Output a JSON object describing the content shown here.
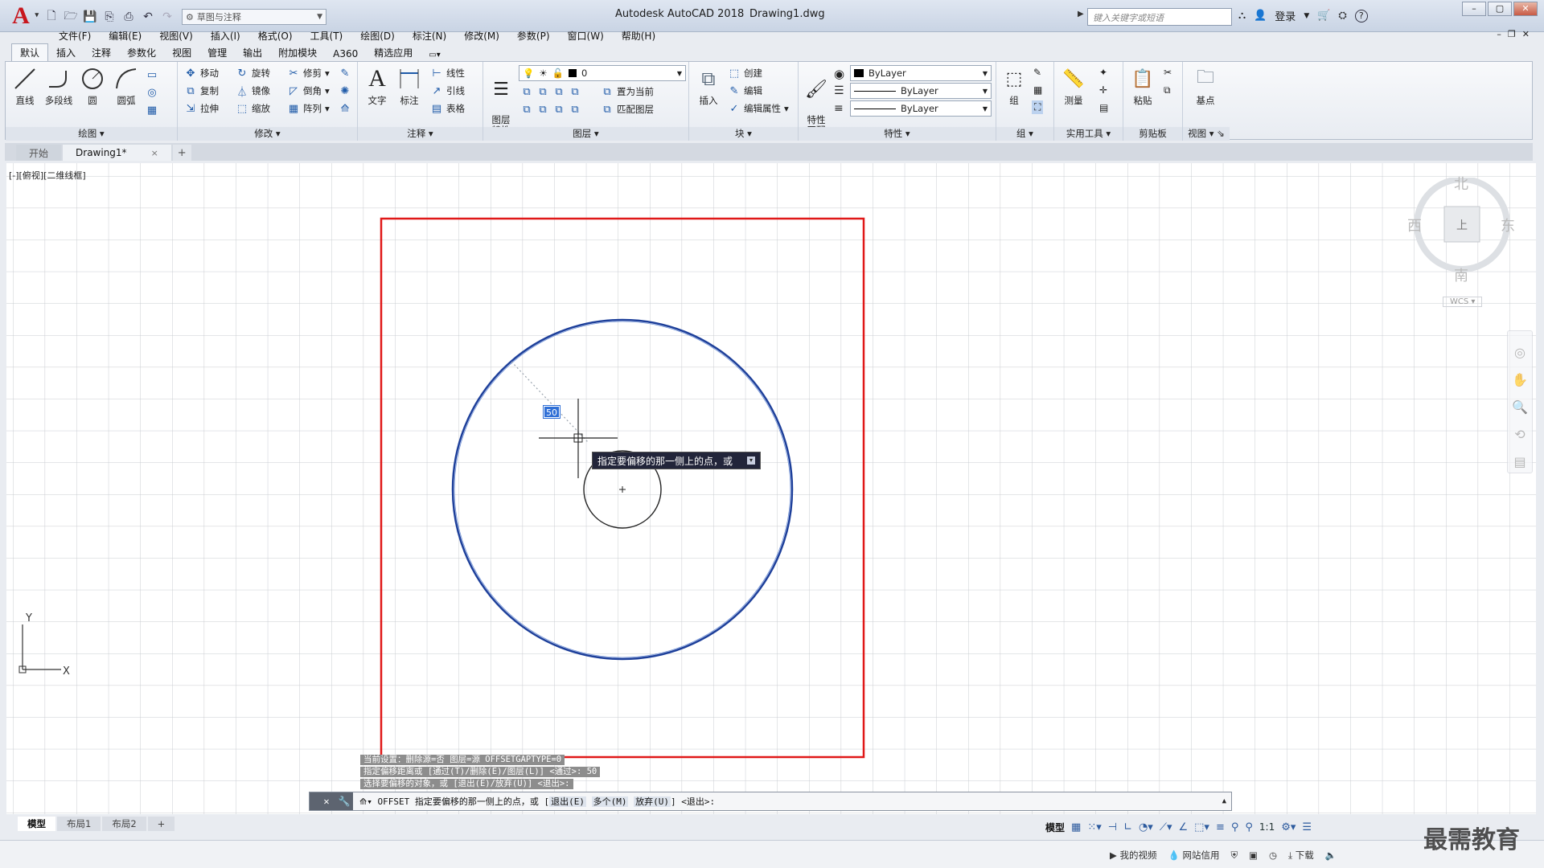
{
  "app": {
    "logo_letter": "A",
    "title": "Autodesk AutoCAD 2018",
    "file": "Drawing1.dwg",
    "workspace": "草图与注释",
    "search_placeholder": "键入关键字或短语",
    "login": "登录",
    "help": "?"
  },
  "menu": [
    "文件(F)",
    "编辑(E)",
    "视图(V)",
    "插入(I)",
    "格式(O)",
    "工具(T)",
    "绘图(D)",
    "标注(N)",
    "修改(M)",
    "参数(P)",
    "窗口(W)",
    "帮助(H)"
  ],
  "ribbon_tabs": [
    "默认",
    "插入",
    "注释",
    "参数化",
    "视图",
    "管理",
    "输出",
    "附加模块",
    "A360",
    "精选应用"
  ],
  "ribbon": {
    "draw": {
      "title": "绘图",
      "big": [
        "直线",
        "多段线",
        "圆",
        "圆弧"
      ]
    },
    "modify": {
      "title": "修改",
      "rows": [
        [
          "移动",
          "旋转",
          "修剪"
        ],
        [
          "复制",
          "镜像",
          "倒角"
        ],
        [
          "拉伸",
          "缩放",
          "阵列"
        ]
      ]
    },
    "annotation": {
      "title": "注释",
      "big": [
        "文字",
        "标注"
      ],
      "rows": [
        "线性",
        "引线",
        "表格"
      ]
    },
    "layers": {
      "title": "图层",
      "big": "图层\n特性",
      "layer_value": "0",
      "rows": [
        "置为当前",
        "匹配图层"
      ]
    },
    "block": {
      "title": "块",
      "big": "插入",
      "rows": [
        "创建",
        "编辑",
        "编辑属性"
      ]
    },
    "properties": {
      "title": "特性",
      "big": "特性\n匹配",
      "color": "ByLayer",
      "linetype": "ByLayer",
      "lineweight": "ByLayer"
    },
    "groups": {
      "title": "组",
      "big": "组"
    },
    "utilities": {
      "title": "实用工具",
      "big": "测量"
    },
    "clipboard": {
      "title": "剪贴板",
      "big": "粘贴"
    },
    "view": {
      "title": "视图",
      "big": "基点"
    }
  },
  "file_tabs": [
    {
      "label": "开始",
      "active": false
    },
    {
      "label": "Drawing1*",
      "active": true,
      "close": "×"
    }
  ],
  "viewport_label": "[-][俯视][二维线框]",
  "viewcube": {
    "north": "北",
    "south": "南",
    "east": "东",
    "west": "西",
    "wcs": "WCS"
  },
  "dynamic_input": "50",
  "tooltip": "指定要偏移的那一侧上的点，或",
  "command_history": [
    "当前设置：删除源=否  图层=源  OFFSETGAPTYPE=0",
    "指定偏移距离或 [通过(T)/删除(E)/图层(L)] <通过>:  50",
    "选择要偏移的对象，或 [退出(E)/放弃(U)] <退出>:"
  ],
  "command_line": {
    "prefix": "OFFSET 指定要偏移的那一侧上的点，或 [",
    "opt1": "退出(E)",
    "opt2": "多个(M)",
    "opt3": "放弃(U)",
    "suffix": "] <退出>:"
  },
  "ucs": {
    "x": "X",
    "y": "Y"
  },
  "layout_tabs": [
    "模型",
    "布局1",
    "布局2"
  ],
  "status": {
    "model": "模型",
    "scale": "1:1"
  },
  "bottom": [
    "我的视频",
    "网站信用",
    "下载"
  ],
  "watermark": "最需教育",
  "colors": {
    "rect": "#e01818",
    "big_circle": "#1d3f9a",
    "small_circle": "#222222",
    "accent": "#2f6fd6"
  }
}
